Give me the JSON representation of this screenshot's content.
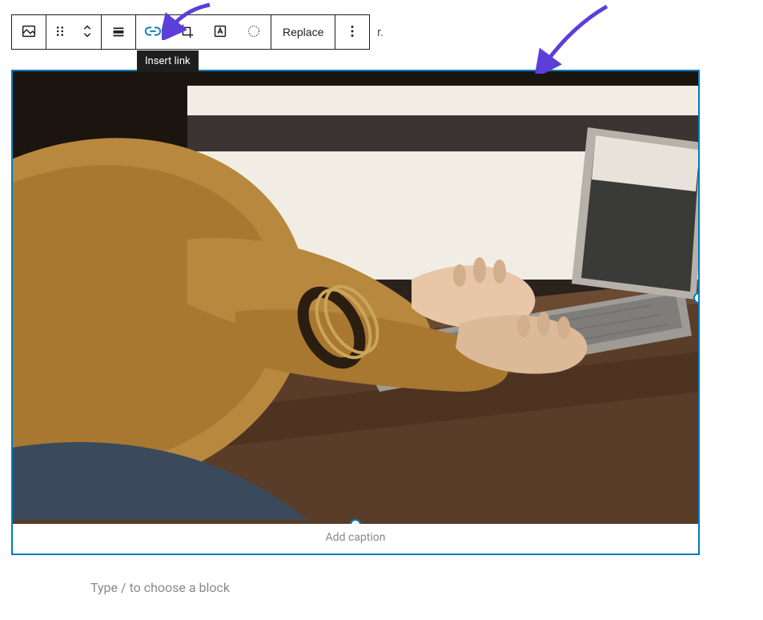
{
  "toolbar": {
    "replace_label": "Replace",
    "link_tooltip": "Insert link"
  },
  "image_block": {
    "caption_placeholder": "Add caption"
  },
  "editor": {
    "block_prompt": "Type / to choose a block",
    "bg_fragment": "r."
  },
  "icons": {
    "image": "image-icon",
    "drag": "drag-icon",
    "move": "move-up-down-icon",
    "align": "align-icon",
    "link": "link-icon",
    "crop": "crop-icon",
    "text_overlay": "text-overlay-icon",
    "duotone": "duotone-icon",
    "more": "more-options-icon"
  }
}
